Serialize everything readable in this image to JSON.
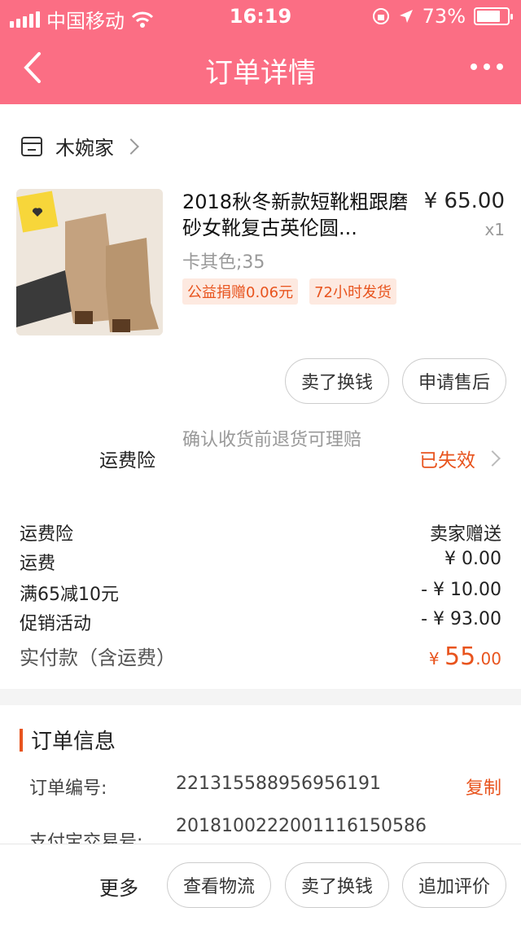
{
  "status_bar": {
    "carrier": "中国移动",
    "time": "16:19",
    "battery": "73%"
  },
  "nav": {
    "title": "订单详情"
  },
  "shop": {
    "name": "木婉家"
  },
  "product": {
    "title": "2018秋冬新款短靴粗跟磨砂女靴复古英伦圆...",
    "price": "¥ 65.00",
    "qty": "x1",
    "sku": "卡其色;35",
    "tags": [
      "公益捐赠0.06元",
      "72小时发货"
    ]
  },
  "item_actions": {
    "sell": "卖了换钱",
    "after_sale": "申请售后"
  },
  "insurance": {
    "label": "运费险",
    "desc": "确认收货前退货可理赔",
    "status": "已失效"
  },
  "fees": [
    {
      "label": "运费险",
      "value": "卖家赠送"
    },
    {
      "label": "运费",
      "value": "¥ 0.00"
    },
    {
      "label": "满65减10元",
      "value": "- ¥ 10.00"
    },
    {
      "label": "促销活动",
      "value": "- ¥ 93.00"
    }
  ],
  "total": {
    "label": "实付款（含运费）",
    "currency": "¥ ",
    "int": "55",
    "dec": ".00"
  },
  "order_info": {
    "heading": "订单信息",
    "order_no_label": "订单编号:",
    "order_no": "221315588956956191",
    "copy": "复制",
    "alipay_label": "支付宝交易号:",
    "alipay_no": "2018100222001116150586"
  },
  "bottom_bar": {
    "more": "更多",
    "logistics": "查看物流",
    "sell": "卖了换钱",
    "review": "追加评价"
  },
  "colors": {
    "brand": "#fb6e84",
    "accent": "#e8541e"
  }
}
